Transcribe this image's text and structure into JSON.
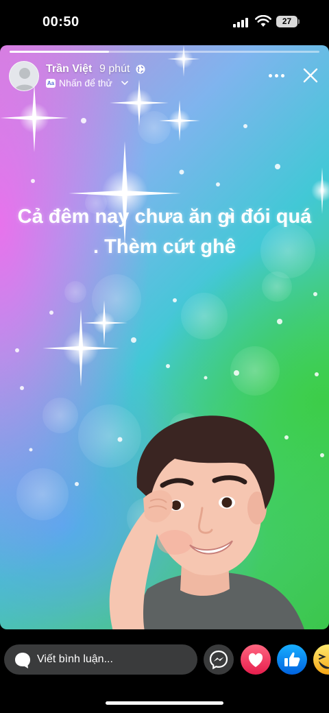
{
  "status_bar": {
    "time": "00:50",
    "battery_level": "27",
    "signal_icon": "cellular-signal-icon",
    "wifi_icon": "wifi-icon",
    "battery_icon": "battery-icon"
  },
  "story": {
    "progress": 0.32,
    "author": "Trần Việt",
    "time_ago": "9 phút",
    "privacy_icon": "globe-icon",
    "font_control": {
      "icon": "Aa",
      "label": "Nhấn để thử"
    },
    "more_icon": "more-horizontal-icon",
    "close_icon": "close-icon",
    "text": "Cả đêm nay chưa ăn gì đói quá . Thèm cứt ghê",
    "colors": {
      "pink": "#ec70ec",
      "blue": "#5aa5f5",
      "cyan": "#42c8d6",
      "green": "#3cc64c"
    }
  },
  "bottom_bar": {
    "comment_placeholder": "Viết bình luận...",
    "reactions": [
      "messenger-icon",
      "love-reaction-icon",
      "like-reaction-icon",
      "haha-reaction-icon"
    ],
    "colors": {
      "comment_bg": "#3a3b3c",
      "love": "#f0284a",
      "like": "#1877f2",
      "haha": "#f7b125"
    }
  }
}
